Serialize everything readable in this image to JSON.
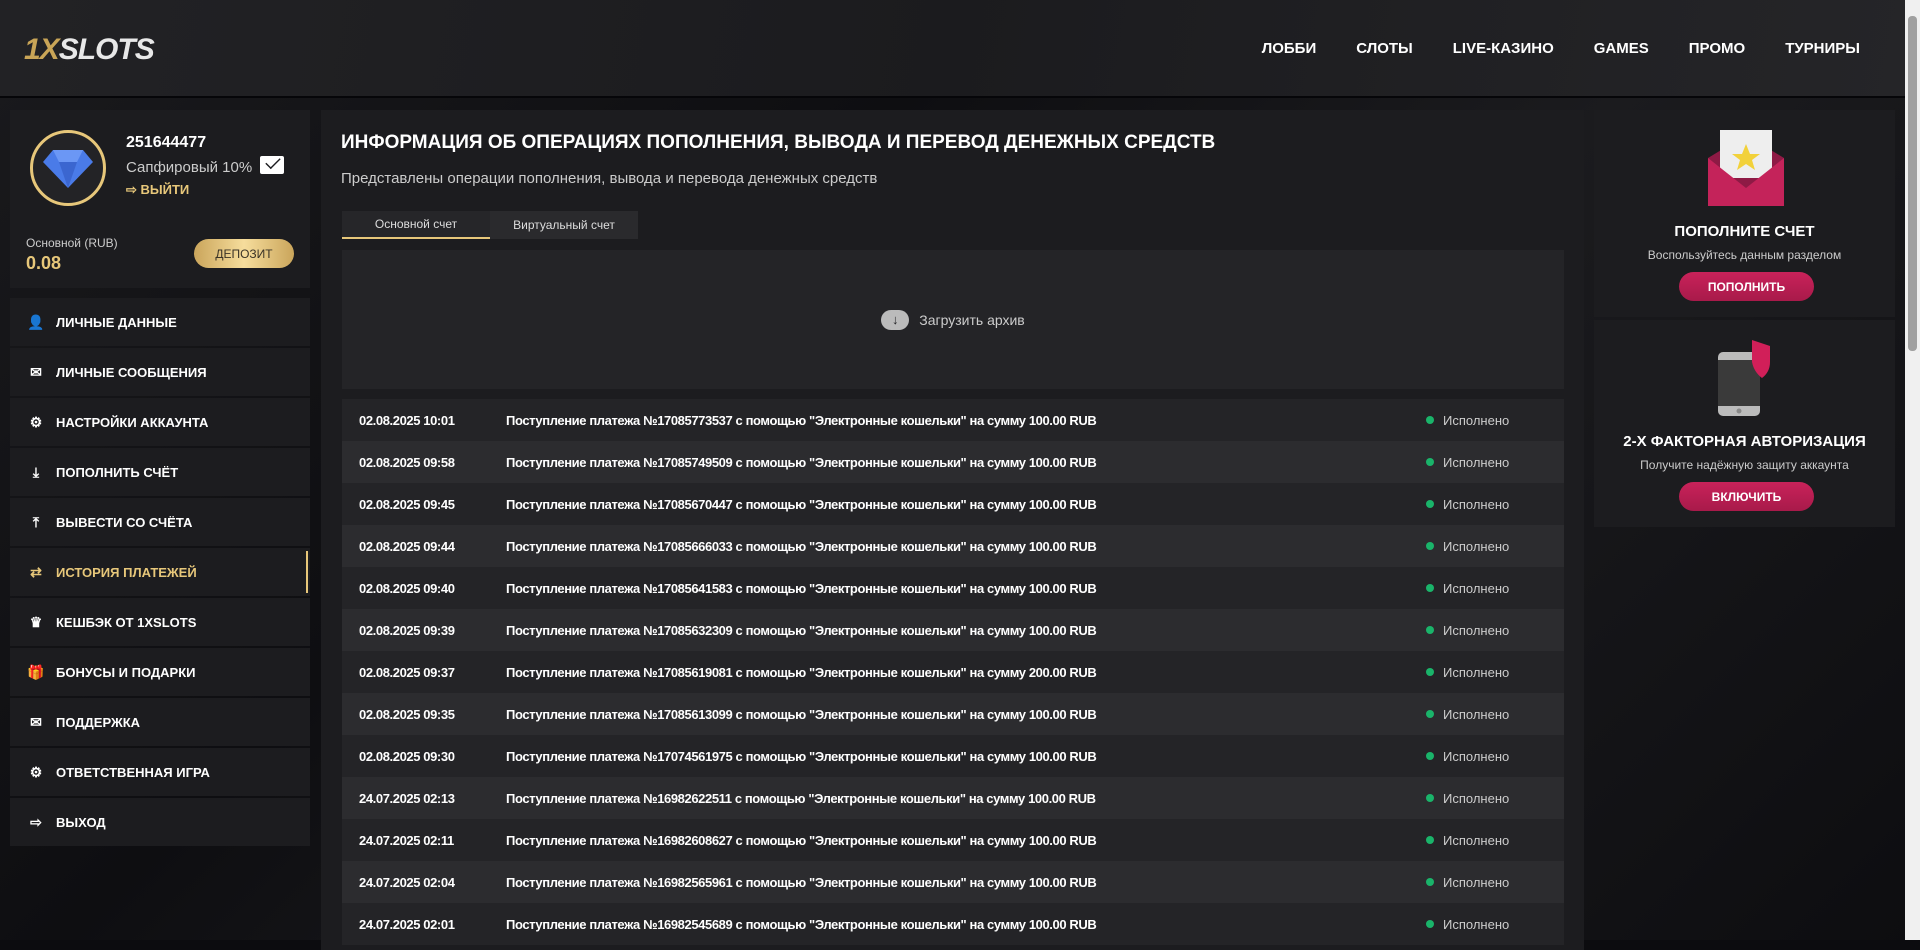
{
  "header": {
    "logo_a": "1X",
    "logo_b": "SLOTS",
    "nav": [
      "ЛОББИ",
      "СЛОТЫ",
      "LIVE-КАЗИНО",
      "GAMES",
      "ПРОМО",
      "ТУРНИРЫ"
    ]
  },
  "profile": {
    "id": "251644477",
    "level": "Сапфировый 10%",
    "logout": "ВЫЙТИ",
    "balance_label": "Основной (RUB)",
    "balance": "0.08",
    "deposit": "ДЕПОЗИТ"
  },
  "menu": [
    {
      "label": "ЛИЧНЫЕ ДАННЫЕ",
      "icon": "user-plus-icon"
    },
    {
      "label": "ЛИЧНЫЕ СООБЩЕНИЯ",
      "icon": "envelope-icon"
    },
    {
      "label": "НАСТРОЙКИ АККАУНТА",
      "icon": "gears-icon"
    },
    {
      "label": "ПОПОЛНИТЬ СЧЁТ",
      "icon": "download-icon"
    },
    {
      "label": "ВЫВЕСТИ СО СЧЁТА",
      "icon": "upload-icon"
    },
    {
      "label": "ИСТОРИЯ ПЛАТЕЖЕЙ",
      "icon": "exchange-icon"
    },
    {
      "label": "КЕШБЭК ОТ 1XSLOTS",
      "icon": "crown-icon"
    },
    {
      "label": "БОНУСЫ И ПОДАРКИ",
      "icon": "gift-icon"
    },
    {
      "label": "ПОДДЕРЖКА",
      "icon": "envelope-icon"
    },
    {
      "label": "ОТВЕТСТВЕННАЯ ИГРА",
      "icon": "gears-icon"
    },
    {
      "label": "ВЫХОД",
      "icon": "sign-out-icon"
    }
  ],
  "main": {
    "title": "ИНФОРМАЦИЯ ОБ ОПЕРАЦИЯХ ПОПОЛНЕНИЯ, ВЫВОДА И ПЕРЕВОД ДЕНЕЖНЫХ СРЕДСТВ",
    "subtitle": "Представлены операции пополнения, вывода и перевода денежных средств",
    "tabs": [
      "Основной счет",
      "Виртуальный счет"
    ],
    "upload": "Загрузить архив",
    "rows": [
      {
        "date": "02.08.2025 10:01",
        "text": "Поступление платежа №17085773537 с помощью \"Электронные кошельки\" на сумму 100.00 RUB",
        "status": "Исполнено"
      },
      {
        "date": "02.08.2025 09:58",
        "text": "Поступление платежа №17085749509 с помощью \"Электронные кошельки\" на сумму 100.00 RUB",
        "status": "Исполнено"
      },
      {
        "date": "02.08.2025 09:45",
        "text": "Поступление платежа №17085670447 с помощью \"Электронные кошельки\" на сумму 100.00 RUB",
        "status": "Исполнено"
      },
      {
        "date": "02.08.2025 09:44",
        "text": "Поступление платежа №17085666033 с помощью \"Электронные кошельки\" на сумму 100.00 RUB",
        "status": "Исполнено"
      },
      {
        "date": "02.08.2025 09:40",
        "text": "Поступление платежа №17085641583 с помощью \"Электронные кошельки\" на сумму 100.00 RUB",
        "status": "Исполнено"
      },
      {
        "date": "02.08.2025 09:39",
        "text": "Поступление платежа №17085632309 с помощью \"Электронные кошельки\" на сумму 100.00 RUB",
        "status": "Исполнено"
      },
      {
        "date": "02.08.2025 09:37",
        "text": "Поступление платежа №17085619081 с помощью \"Электронные кошельки\" на сумму 200.00 RUB",
        "status": "Исполнено"
      },
      {
        "date": "02.08.2025 09:35",
        "text": "Поступление платежа №17085613099 с помощью \"Электронные кошельки\" на сумму 100.00 RUB",
        "status": "Исполнено"
      },
      {
        "date": "02.08.2025 09:30",
        "text": "Поступление платежа №17074561975 с помощью \"Электронные кошельки\" на сумму 100.00 RUB",
        "status": "Исполнено"
      },
      {
        "date": "24.07.2025 02:13",
        "text": "Поступление платежа №16982622511 с помощью \"Электронные кошельки\" на сумму 100.00 RUB",
        "status": "Исполнено"
      },
      {
        "date": "24.07.2025 02:11",
        "text": "Поступление платежа №16982608627 с помощью \"Электронные кошельки\" на сумму 100.00 RUB",
        "status": "Исполнено"
      },
      {
        "date": "24.07.2025 02:04",
        "text": "Поступление платежа №16982565961 с помощью \"Электронные кошельки\" на сумму 100.00 RUB",
        "status": "Исполнено"
      },
      {
        "date": "24.07.2025 02:01",
        "text": "Поступление платежа №16982545689 с помощью \"Электронные кошельки\" на сумму 100.00 RUB",
        "status": "Исполнено"
      }
    ]
  },
  "promo": [
    {
      "title": "ПОПОЛНИТЕ СЧЕТ",
      "text": "Воспользуйтесь данным разделом",
      "button": "ПОПОЛНИТЬ"
    },
    {
      "title": "2-Х ФАКТОРНАЯ АВТОРИЗАЦИЯ",
      "text": "Получите надёжную защиту аккаунта",
      "button": "ВКЛЮЧИТЬ"
    }
  ],
  "colors": {
    "gold": "#e7c77a",
    "accent": "#c9225a",
    "success": "#1ab46a"
  }
}
